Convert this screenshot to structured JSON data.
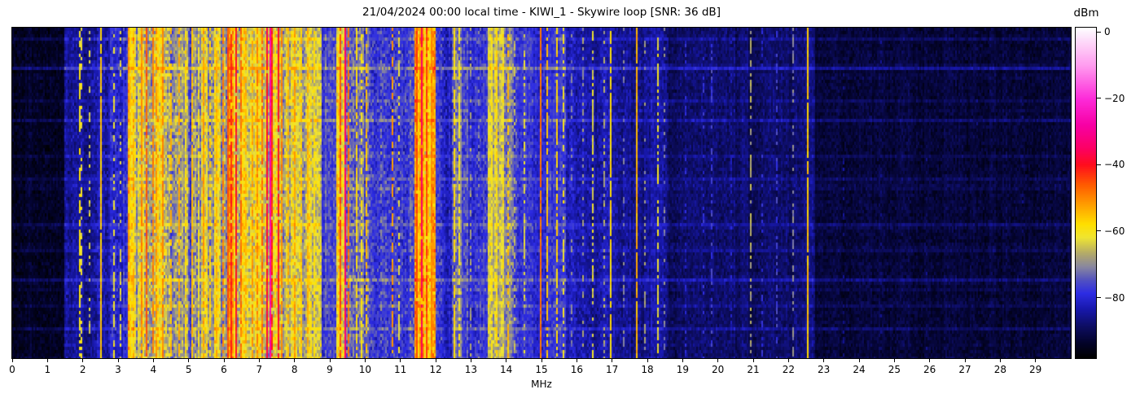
{
  "title": "21/04/2024 00:00 local time - KIWI_1 - Skywire loop [SNR: 36 dB]",
  "x_axis": {
    "label": "MHz",
    "min": 0,
    "max": 30,
    "ticks": [
      0,
      1,
      2,
      3,
      4,
      5,
      6,
      7,
      8,
      9,
      10,
      11,
      12,
      13,
      14,
      15,
      16,
      17,
      18,
      19,
      20,
      21,
      22,
      23,
      24,
      25,
      26,
      27,
      28,
      29
    ],
    "tick_labels": [
      "0",
      "1",
      "2",
      "3",
      "4",
      "5",
      "6",
      "7",
      "8",
      "9",
      "10",
      "11",
      "12",
      "13",
      "14",
      "15",
      "16",
      "17",
      "18",
      "19",
      "20",
      "21",
      "22",
      "23",
      "24",
      "25",
      "26",
      "27",
      "28",
      "29"
    ]
  },
  "y_axis": {
    "label": "",
    "ticks": [],
    "note": "time axis, no ticks shown"
  },
  "colorbar": {
    "label": "dBm",
    "vmax": 1.5,
    "vmin": -98.5,
    "ticks": [
      0,
      -20,
      -40,
      -60,
      -80
    ],
    "tick_labels": [
      "0",
      "−20",
      "−40",
      "−60",
      "−80"
    ]
  },
  "chart_data": {
    "type": "heatmap",
    "subtype": "radio-spectrogram-waterfall",
    "x_unit": "MHz",
    "x_range": [
      0,
      30
    ],
    "value_unit": "dBm",
    "value_range": [
      -98.5,
      1.5
    ],
    "snr_db": 36,
    "station": "KIWI_1",
    "antenna": "Skywire loop",
    "datetime_local": "21/04/2024 00:00",
    "colormap_stops": [
      [
        -98.5,
        "#000000"
      ],
      [
        -94,
        "#03032a"
      ],
      [
        -89,
        "#0d0d62"
      ],
      [
        -84,
        "#1717a8"
      ],
      [
        -79,
        "#2d2ce4"
      ],
      [
        -75,
        "#5251c1"
      ],
      [
        -71,
        "#8886a0"
      ],
      [
        -67,
        "#b2a96b"
      ],
      [
        -62,
        "#f0e531"
      ],
      [
        -58,
        "#ffdf00"
      ],
      [
        -52,
        "#ff9d00"
      ],
      [
        -46,
        "#ff5a00"
      ],
      [
        -40,
        "#ff0d1d"
      ],
      [
        -35,
        "#fc0064"
      ],
      [
        -28,
        "#f700a4"
      ],
      [
        -20,
        "#fd2bd9"
      ],
      [
        -10,
        "#ff9bef"
      ],
      [
        0,
        "#fdf0fd"
      ],
      [
        1.5,
        "#ffffff"
      ]
    ],
    "noise_bands_fields": [
      "from_mhz",
      "to_mhz",
      "level_dbm",
      "stripe_var_db",
      "noise_db"
    ],
    "noise_bands": [
      [
        0.0,
        1.5,
        -95,
        1.5,
        3.5
      ],
      [
        1.5,
        2.42,
        -86,
        3,
        5
      ],
      [
        2.42,
        3.3,
        -83,
        5,
        6
      ],
      [
        3.3,
        4.5,
        -62,
        10,
        8
      ],
      [
        4.5,
        5.1,
        -71,
        9,
        8
      ],
      [
        5.1,
        6.1,
        -66,
        9,
        8
      ],
      [
        6.1,
        6.55,
        -58,
        9,
        8
      ],
      [
        6.55,
        7.2,
        -62,
        9,
        8
      ],
      [
        7.2,
        7.65,
        -57,
        10,
        8
      ],
      [
        7.65,
        8.75,
        -64,
        9,
        8
      ],
      [
        8.75,
        9.2,
        -79,
        5,
        6
      ],
      [
        9.2,
        9.6,
        -65,
        9,
        8
      ],
      [
        9.6,
        10.15,
        -70,
        8,
        8
      ],
      [
        10.15,
        11.4,
        -77,
        4,
        7
      ],
      [
        11.4,
        12.0,
        -57,
        9,
        8
      ],
      [
        12.0,
        12.45,
        -80,
        4,
        6
      ],
      [
        12.45,
        12.75,
        -70,
        7,
        7
      ],
      [
        12.75,
        13.5,
        -78,
        4,
        6
      ],
      [
        13.5,
        13.95,
        -68,
        7,
        7
      ],
      [
        13.95,
        14.35,
        -74,
        6,
        7
      ],
      [
        14.35,
        15.7,
        -80,
        3,
        5.5
      ],
      [
        15.7,
        17.0,
        -84,
        3,
        5
      ],
      [
        17.0,
        18.6,
        -86,
        2.5,
        4.5
      ],
      [
        18.6,
        22.4,
        -89,
        2,
        4
      ],
      [
        22.4,
        22.75,
        -88,
        2,
        4
      ],
      [
        22.75,
        30.0,
        -93,
        1.5,
        3.5
      ]
    ],
    "carriers_fields": [
      "freq_mhz",
      "peak_dbm",
      "duty"
    ],
    "carriers": [
      [
        1.87,
        -60,
        0.55
      ],
      [
        1.96,
        -62,
        0.4
      ],
      [
        2.17,
        -64,
        0.35
      ],
      [
        2.5,
        -56,
        0.95
      ],
      [
        2.88,
        -62,
        0.5
      ],
      [
        3.06,
        -64,
        0.4
      ],
      [
        3.34,
        -57,
        0.8
      ],
      [
        3.63,
        -50,
        0.9
      ],
      [
        3.78,
        -46,
        0.9
      ],
      [
        3.95,
        -49,
        0.85
      ],
      [
        4.08,
        -52,
        0.8
      ],
      [
        4.24,
        -50,
        0.85
      ],
      [
        4.46,
        -55,
        0.7
      ],
      [
        4.72,
        -54,
        0.7
      ],
      [
        4.88,
        -58,
        0.6
      ],
      [
        5.06,
        -55,
        0.8
      ],
      [
        5.26,
        -60,
        0.6
      ],
      [
        5.42,
        -52,
        0.8
      ],
      [
        5.6,
        -57,
        0.7
      ],
      [
        5.77,
        -54,
        0.8
      ],
      [
        5.94,
        -50,
        0.85
      ],
      [
        6.07,
        -46,
        0.9
      ],
      [
        6.19,
        -42,
        0.9
      ],
      [
        6.31,
        -40,
        0.95
      ],
      [
        6.45,
        -48,
        0.8
      ],
      [
        6.62,
        -54,
        0.7
      ],
      [
        6.78,
        -52,
        0.75
      ],
      [
        6.92,
        -50,
        0.8
      ],
      [
        7.08,
        -48,
        0.8
      ],
      [
        7.22,
        -38,
        0.95
      ],
      [
        7.29,
        -26,
        1
      ],
      [
        7.36,
        -42,
        0.9
      ],
      [
        7.5,
        -40,
        0.95
      ],
      [
        7.63,
        -50,
        0.8
      ],
      [
        7.82,
        -54,
        0.7
      ],
      [
        8.0,
        -52,
        0.75
      ],
      [
        8.17,
        -56,
        0.7
      ],
      [
        8.36,
        -54,
        0.7
      ],
      [
        8.56,
        -59,
        0.6
      ],
      [
        8.96,
        -74,
        0.4
      ],
      [
        9.29,
        -45,
        0.9
      ],
      [
        9.42,
        -34,
        0.95
      ],
      [
        9.53,
        -49,
        0.8
      ],
      [
        9.72,
        -58,
        0.7
      ],
      [
        9.87,
        -60,
        0.6
      ],
      [
        10.02,
        -55,
        0.8
      ],
      [
        10.45,
        -70,
        0.35
      ],
      [
        10.76,
        -52,
        0.6
      ],
      [
        10.92,
        -62,
        0.4
      ],
      [
        11.45,
        -45,
        0.9
      ],
      [
        11.58,
        -36,
        0.95
      ],
      [
        11.73,
        -44,
        0.9
      ],
      [
        11.86,
        -50,
        0.9
      ],
      [
        11.95,
        -56,
        0.8
      ],
      [
        12.12,
        -74,
        0.3
      ],
      [
        12.52,
        -58,
        0.8
      ],
      [
        12.64,
        -61,
        0.7
      ],
      [
        12.97,
        -68,
        0.4
      ],
      [
        13.22,
        -71,
        0.3
      ],
      [
        13.58,
        -60,
        0.8
      ],
      [
        13.71,
        -58,
        0.8
      ],
      [
        13.86,
        -63,
        0.7
      ],
      [
        14.02,
        -55,
        0.6
      ],
      [
        14.22,
        -66,
        0.4
      ],
      [
        14.5,
        -63,
        0.5
      ],
      [
        14.95,
        -48,
        0.97
      ],
      [
        15.12,
        -56,
        0.8
      ],
      [
        15.4,
        -57,
        0.75
      ],
      [
        15.62,
        -61,
        0.5
      ],
      [
        15.83,
        -71,
        0.3
      ],
      [
        16.17,
        -69,
        0.3
      ],
      [
        16.41,
        -63,
        0.5
      ],
      [
        16.76,
        -67,
        0.4
      ],
      [
        16.96,
        -58,
        0.85
      ],
      [
        17.32,
        -71,
        0.3
      ],
      [
        17.66,
        -54,
        0.95
      ],
      [
        17.92,
        -69,
        0.3
      ],
      [
        18.27,
        -62,
        0.55
      ],
      [
        18.47,
        -71,
        0.3
      ],
      [
        19.05,
        -80,
        0.25
      ],
      [
        19.55,
        -79,
        0.2
      ],
      [
        19.82,
        -77,
        0.3
      ],
      [
        20.35,
        -81,
        0.2
      ],
      [
        20.91,
        -67,
        0.55
      ],
      [
        21.22,
        -79,
        0.3
      ],
      [
        21.66,
        -77,
        0.4
      ],
      [
        22.12,
        -71,
        0.45
      ],
      [
        22.51,
        -56,
        0.95
      ],
      [
        23.55,
        -86,
        0.2
      ],
      [
        24.6,
        -87,
        0.15
      ],
      [
        25.9,
        -87,
        0.15
      ],
      [
        27.3,
        -88,
        0.12
      ],
      [
        28.6,
        -88,
        0.1
      ]
    ],
    "streak_rows_fields": [
      "row",
      "boost_db"
    ],
    "streak_rows": [
      [
        3,
        4
      ],
      [
        12,
        8
      ],
      [
        22,
        3
      ],
      [
        28,
        5
      ],
      [
        39,
        3
      ],
      [
        46,
        3.5
      ],
      [
        60,
        4.5
      ],
      [
        68,
        3
      ],
      [
        77,
        6
      ],
      [
        85,
        3
      ],
      [
        92,
        4.5
      ]
    ],
    "legend_position": "right-colorbar",
    "grid": false
  }
}
